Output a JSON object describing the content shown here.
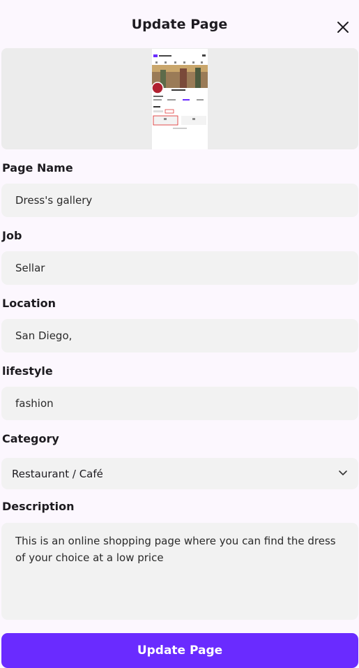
{
  "header": {
    "title": "Update Page",
    "close_icon": "close-icon"
  },
  "preview": {
    "image": "page-screenshot-thumbnail"
  },
  "form": {
    "page_name": {
      "label": "Page Name",
      "value": "Dress's gallery"
    },
    "job": {
      "label": "Job",
      "value": "Sellar"
    },
    "location": {
      "label": "Location",
      "value": "San Diego,"
    },
    "lifestyle": {
      "label": "lifestyle",
      "value": "fashion"
    },
    "category": {
      "label": "Category",
      "value": "Restaurant / Café",
      "icon": "chevron-down-icon"
    },
    "description": {
      "label": "Description",
      "value": "This is an online shopping page where you can find the dress of your choice at a low price"
    }
  },
  "submit": {
    "label": "Update Page"
  },
  "colors": {
    "accent": "#6a2bff",
    "background": "#fcf7fe",
    "field": "#f2f2f2"
  }
}
